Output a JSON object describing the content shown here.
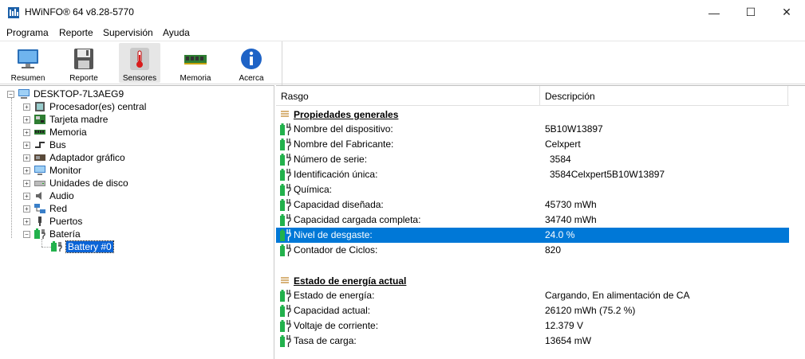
{
  "window": {
    "title": "HWiNFO® 64 v8.28-5770",
    "controls": {
      "minimize": "—",
      "maximize": "☐",
      "close": "✕"
    }
  },
  "menu": [
    {
      "label": "Programa"
    },
    {
      "label": "Reporte"
    },
    {
      "label": "Supervisión"
    },
    {
      "label": "Ayuda"
    }
  ],
  "toolbar": {
    "buttons": [
      {
        "label": "Resumen",
        "icon": "monitor-icon"
      },
      {
        "label": "Reporte",
        "icon": "floppy-disk-icon"
      },
      {
        "label": "Sensores",
        "icon": "thermometer-icon"
      },
      {
        "label": "Memoria",
        "icon": "memory-module-icon"
      },
      {
        "label": "Acerca",
        "icon": "info-icon"
      }
    ]
  },
  "tree": {
    "root": "DESKTOP-7L3AEG9",
    "items": [
      {
        "label": "Procesador(es) central",
        "icon": "cpu-icon"
      },
      {
        "label": "Tarjeta madre",
        "icon": "motherboard-icon"
      },
      {
        "label": "Memoria",
        "icon": "memory-icon"
      },
      {
        "label": "Bus",
        "icon": "bus-icon"
      },
      {
        "label": "Adaptador gráfico",
        "icon": "gpu-icon"
      },
      {
        "label": "Monitor",
        "icon": "monitor-icon"
      },
      {
        "label": "Unidades de disco",
        "icon": "disk-icon"
      },
      {
        "label": "Audio",
        "icon": "speaker-icon"
      },
      {
        "label": "Red",
        "icon": "network-icon"
      },
      {
        "label": "Puertos",
        "icon": "port-icon"
      },
      {
        "label": "Batería",
        "icon": "battery-icon"
      }
    ],
    "child": {
      "label": "Battery #0",
      "icon": "battery-icon"
    }
  },
  "details": {
    "columns": {
      "left": "Rasgo",
      "right": "Descripción"
    },
    "sections": [
      {
        "title": "Propiedades generales",
        "rows": [
          {
            "k": "Nombre del dispositivo:",
            "v": "5B10W13897"
          },
          {
            "k": "Nombre del Fabricante:",
            "v": "Celxpert"
          },
          {
            "k": "Número de serie:",
            "v": "3584"
          },
          {
            "k": "Identificación única:",
            "v": "3584Celxpert5B10W13897"
          },
          {
            "k": "Química:",
            "v": ""
          },
          {
            "k": "Capacidad diseñada:",
            "v": "45730 mWh"
          },
          {
            "k": "Capacidad cargada completa:",
            "v": "34740 mWh"
          },
          {
            "k": "Nivel de desgaste:",
            "v": "24.0 %"
          },
          {
            "k": "Contador de Ciclos:",
            "v": "820"
          }
        ]
      },
      {
        "title": "Estado de energía actual",
        "rows": [
          {
            "k": "Estado de energía:",
            "v": "Cargando, En alimentación de CA"
          },
          {
            "k": "Capacidad actual:",
            "v": "26120 mWh (75.2 %)"
          },
          {
            "k": "Voltaje de corriente:",
            "v": "12.379 V"
          },
          {
            "k": "Tasa de carga:",
            "v": "13654 mW"
          }
        ]
      }
    ]
  },
  "colors": {
    "selection": "#0078d7",
    "battery_green": "#22b14c"
  }
}
